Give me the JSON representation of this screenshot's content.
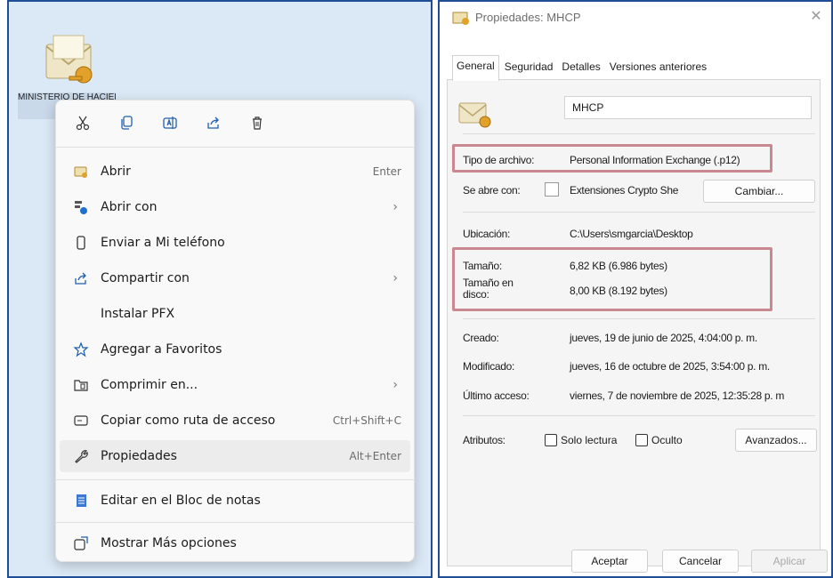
{
  "desktop": {
    "icon_label": "MINISTERIO DE HACIENDA"
  },
  "context_menu": {
    "quick_actions": [
      "cut",
      "copy",
      "rename",
      "share",
      "delete"
    ],
    "items": [
      {
        "label": "Abrir",
        "shortcut": "Enter",
        "icon": "open-icon"
      },
      {
        "label": "Abrir con",
        "icon": "open-with-icon"
      },
      {
        "label": "Enviar a Mi teléfono",
        "icon": "phone-icon"
      },
      {
        "label": "Compartir con",
        "icon": "share-icon"
      },
      {
        "label": "Instalar PFX"
      },
      {
        "label": "Agregar a Favoritos",
        "icon": "star-icon"
      },
      {
        "label": "Comprimir en...",
        "icon": "compress-icon"
      },
      {
        "label": "Copiar como ruta de acceso",
        "shortcut": "Ctrl+Shift+C",
        "icon": "path-icon"
      },
      {
        "label": "Propiedades",
        "shortcut": "Alt+Enter",
        "icon": "wrench-icon"
      },
      {
        "label": "Editar en el Bloc de notas",
        "icon": "notepad-icon"
      },
      {
        "label": "Mostrar Más opciones",
        "icon": "more-options-icon"
      }
    ]
  },
  "dialog": {
    "title": "Propiedades: MHCP",
    "tabs": [
      "General",
      "Seguridad",
      "Detalles",
      "Versiones anteriores"
    ],
    "file_name": "MHCP",
    "type_label": "Tipo de archivo:",
    "type_value": "Personal Information Exchange (.p12)",
    "opens_with_label": "Se abre con:",
    "opens_with_value": "Extensiones Crypto She",
    "change_button": "Cambiar...",
    "location_label": "Ubicación:",
    "location_value": "C:\\Users\\smgarcia\\Desktop",
    "size_label": "Tamaño:",
    "size_value": "6,82 KB (6.986 bytes)",
    "disk_size_label": "Tamaño en disco:",
    "disk_size_value": "8,00 KB (8.192 bytes)",
    "created_label": "Creado:",
    "created_value": "jueves, 19 de junio de 2025, 4:04:00 p. m.",
    "modified_label": "Modificado:",
    "modified_value": "jueves, 16 de octubre de 2025, 3:54:00 p. m.",
    "accessed_label": "Último acceso:",
    "accessed_value": "viernes, 7 de noviembre de 2025, 12:35:28 p. m",
    "attributes_label": "Atributos:",
    "readonly_label": "Solo lectura",
    "hidden_label": "Oculto",
    "advanced_button": "Avanzados...",
    "ok_button": "Aceptar",
    "cancel_button": "Cancelar",
    "apply_button": "Aplicar"
  },
  "colors": {
    "panel_border": "#1f4d96",
    "highlight_box": "#c9888f",
    "accent_icon": "#1e5fb3"
  }
}
